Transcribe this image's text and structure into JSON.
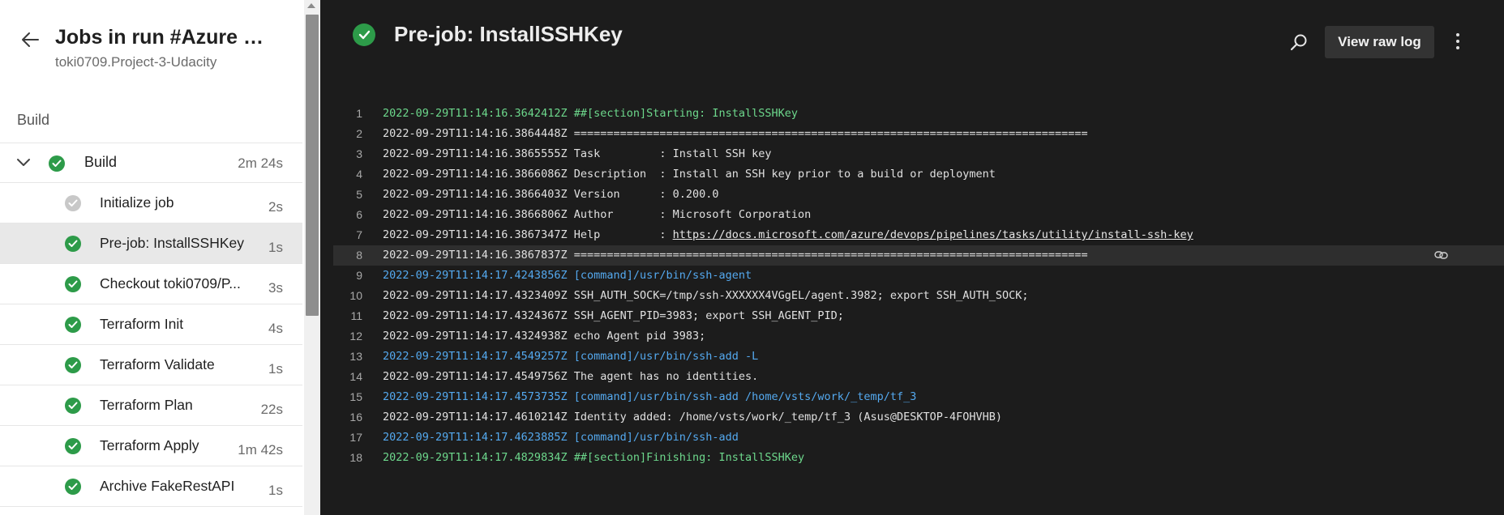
{
  "sidebar": {
    "title": "Jobs in run #Azure Pi...",
    "project": "toki0709.Project-3-Udacity",
    "section": "Build",
    "stage": {
      "name": "Build",
      "duration": "2m 24s",
      "status": "succeeded"
    },
    "jobs": [
      {
        "name": "Initialize job",
        "duration": "2s",
        "status": "pending"
      },
      {
        "name": "Pre-job: InstallSSHKey",
        "duration": "1s",
        "status": "succeeded",
        "selected": true
      },
      {
        "name": "Checkout toki0709/P...",
        "duration": "3s",
        "status": "succeeded"
      },
      {
        "name": "Terraform Init",
        "duration": "4s",
        "status": "succeeded"
      },
      {
        "name": "Terraform Validate",
        "duration": "1s",
        "status": "succeeded"
      },
      {
        "name": "Terraform Plan",
        "duration": "22s",
        "status": "succeeded"
      },
      {
        "name": "Terraform Apply",
        "duration": "1m 42s",
        "status": "succeeded"
      },
      {
        "name": "Archive FakeRestAPI",
        "duration": "1s",
        "status": "succeeded"
      }
    ]
  },
  "log": {
    "title": "Pre-job: InstallSSHKey",
    "view_raw_label": "View raw log",
    "lines": [
      {
        "n": "1",
        "text": "2022-09-29T11:14:16.3642412Z ##[section]Starting: InstallSSHKey",
        "kind": "section"
      },
      {
        "n": "2",
        "text": "2022-09-29T11:14:16.3864448Z ==============================================================================",
        "kind": "normal"
      },
      {
        "n": "3",
        "text": "2022-09-29T11:14:16.3865555Z Task         : Install SSH key",
        "kind": "normal"
      },
      {
        "n": "4",
        "text": "2022-09-29T11:14:16.3866086Z Description  : Install an SSH key prior to a build or deployment",
        "kind": "normal"
      },
      {
        "n": "5",
        "text": "2022-09-29T11:14:16.3866403Z Version      : 0.200.0",
        "kind": "normal"
      },
      {
        "n": "6",
        "text": "2022-09-29T11:14:16.3866806Z Author       : Microsoft Corporation",
        "kind": "normal"
      },
      {
        "n": "7",
        "text": "2022-09-29T11:14:16.3867347Z Help         : ",
        "link": "https://docs.microsoft.com/azure/devops/pipelines/tasks/utility/install-ssh-key",
        "kind": "normal"
      },
      {
        "n": "8",
        "text": "2022-09-29T11:14:16.3867837Z ==============================================================================",
        "kind": "normal",
        "highlight": true
      },
      {
        "n": "9",
        "text": "2022-09-29T11:14:17.4243856Z [command]/usr/bin/ssh-agent",
        "kind": "command"
      },
      {
        "n": "10",
        "text": "2022-09-29T11:14:17.4323409Z SSH_AUTH_SOCK=/tmp/ssh-XXXXXX4VGgEL/agent.3982; export SSH_AUTH_SOCK;",
        "kind": "normal"
      },
      {
        "n": "11",
        "text": "2022-09-29T11:14:17.4324367Z SSH_AGENT_PID=3983; export SSH_AGENT_PID;",
        "kind": "normal"
      },
      {
        "n": "12",
        "text": "2022-09-29T11:14:17.4324938Z echo Agent pid 3983;",
        "kind": "normal"
      },
      {
        "n": "13",
        "text": "2022-09-29T11:14:17.4549257Z [command]/usr/bin/ssh-add -L",
        "kind": "command"
      },
      {
        "n": "14",
        "text": "2022-09-29T11:14:17.4549756Z The agent has no identities.",
        "kind": "normal"
      },
      {
        "n": "15",
        "text": "2022-09-29T11:14:17.4573735Z [command]/usr/bin/ssh-add /home/vsts/work/_temp/tf_3",
        "kind": "command"
      },
      {
        "n": "16",
        "text": "2022-09-29T11:14:17.4610214Z Identity added: /home/vsts/work/_temp/tf_3 (Asus@DESKTOP-4FOHVHB)",
        "kind": "normal"
      },
      {
        "n": "17",
        "text": "2022-09-29T11:14:17.4623885Z [command]/usr/bin/ssh-add",
        "kind": "command"
      },
      {
        "n": "18",
        "text": "2022-09-29T11:14:17.4829834Z ##[section]Finishing: InstallSSHKey",
        "kind": "section"
      }
    ]
  },
  "colors": {
    "success": "#2d9b49",
    "pending": "#c8c8c8",
    "section_text": "#6dd88c",
    "command_text": "#54a9ef",
    "log_background": "#1c1c1c"
  },
  "icons": {
    "back": "arrow-left-icon",
    "search": "search-icon",
    "more": "more-vertical-icon",
    "chevron": "chevron-down-icon",
    "status_ok": "check-circle-icon",
    "link": "link-icon"
  }
}
